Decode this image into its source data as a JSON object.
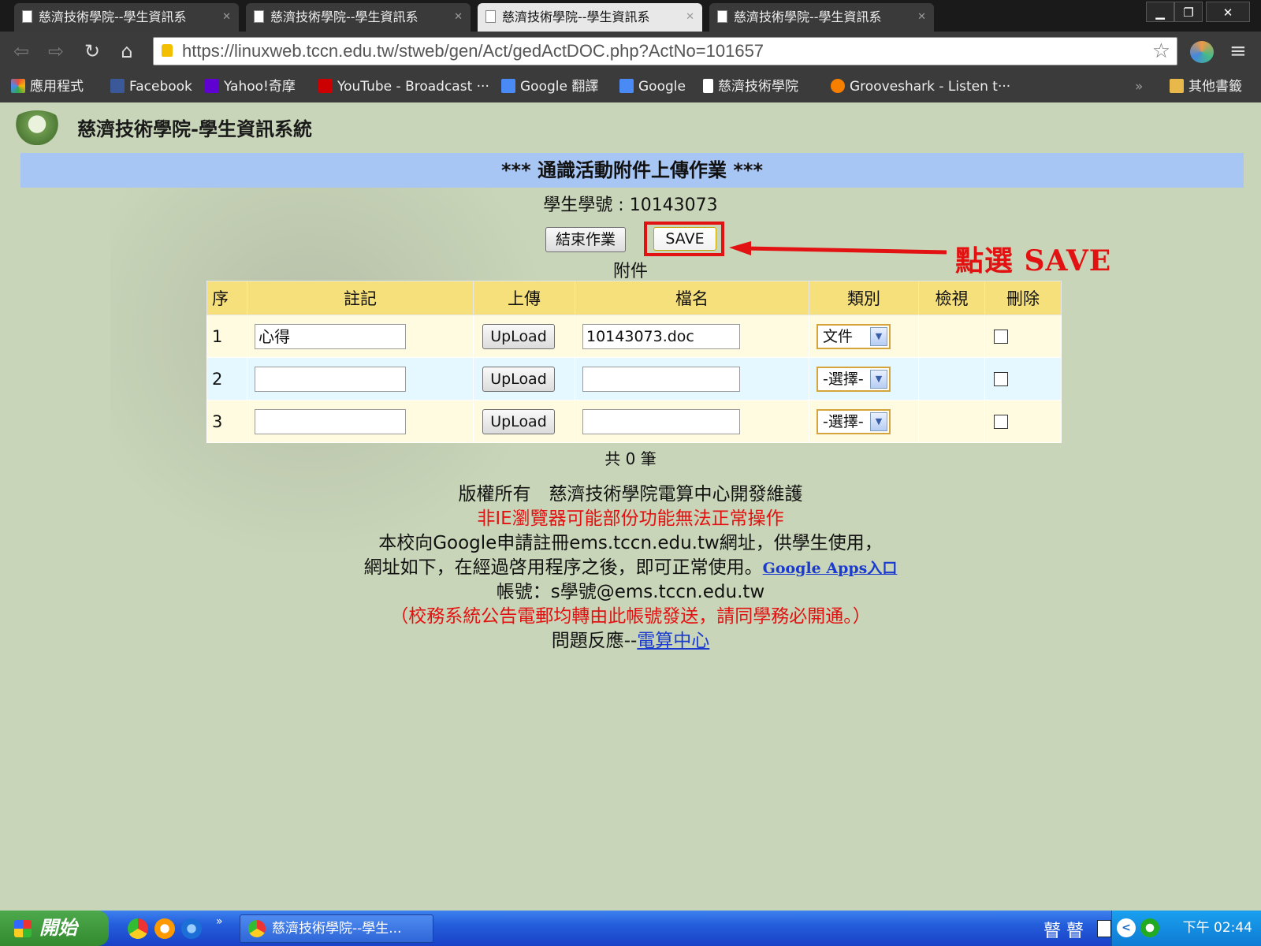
{
  "browser": {
    "tabs": [
      {
        "title": "慈濟技術學院--學生資訊系"
      },
      {
        "title": "慈濟技術學院--學生資訊系"
      },
      {
        "title": "慈濟技術學院--學生資訊系"
      },
      {
        "title": "慈濟技術學院--學生資訊系"
      }
    ],
    "url": "https://linuxweb.tccn.edu.tw/stweb/gen/Act/gedActDOC.php?ActNo=101657",
    "bookmarks": [
      {
        "label": "應用程式",
        "icon": "apps-grid-icon",
        "color": "#e94b3c"
      },
      {
        "label": "Facebook",
        "icon": "facebook-icon",
        "color": "#3b5998"
      },
      {
        "label": "Yahoo!奇摩",
        "icon": "yahoo-icon",
        "color": "#5f01d1"
      },
      {
        "label": "YouTube - Broadcast ···",
        "icon": "youtube-icon",
        "color": "#cc0000"
      },
      {
        "label": "Google 翻譯",
        "icon": "translate-icon",
        "color": "#4a8af4"
      },
      {
        "label": "Google",
        "icon": "google-icon",
        "color": "#4a8af4"
      },
      {
        "label": "慈濟技術學院",
        "icon": "page-icon",
        "color": "#ffffff"
      },
      {
        "label": "Grooveshark - Listen t···",
        "icon": "grooveshark-icon",
        "color": "#f77f00"
      }
    ],
    "more_bookmarks": "»",
    "other_bookmarks": "其他書籤"
  },
  "page": {
    "site_title": "慈濟技術學院-學生資訊系統",
    "banner": "*** 通識活動附件上傳作業 ***",
    "student_id_label": "學生學號 : 10143073",
    "end_button": "結束作業",
    "save_button": "SAVE",
    "callout": "點選 SAVE",
    "attachment_heading": "附件",
    "table": {
      "headers": [
        "序",
        "註記",
        "上傳",
        "檔名",
        "類別",
        "檢視",
        "刪除"
      ],
      "rows": [
        {
          "seq": "1",
          "note": "心得",
          "upload": "UpLoad",
          "filename": "10143073.doc",
          "category": "文件",
          "view": "",
          "delete": false
        },
        {
          "seq": "2",
          "note": "",
          "upload": "UpLoad",
          "filename": "",
          "category": "-選擇-",
          "view": "",
          "delete": false
        },
        {
          "seq": "3",
          "note": "",
          "upload": "UpLoad",
          "filename": "",
          "category": "-選擇-",
          "view": "",
          "delete": false
        }
      ]
    },
    "total": "共 0 筆",
    "footer": {
      "copyright": "版權所有　慈濟技術學院電算中心開發維護",
      "browser_warning": "非IE瀏覽器可能部份功能無法正常操作",
      "google_line1": "本校向Google申請註冊ems.tccn.edu.tw網址，供學生使用，",
      "google_line2": "網址如下，在經過啓用程序之後，即可正常使用。",
      "google_link": "Google Apps入口",
      "account": "帳號：s學號@ems.tccn.edu.tw",
      "notice": "（校務系統公告電郵均轉由此帳號發送，請同學務必開通。）",
      "feedback_prefix": "問題反應--",
      "feedback_link": "電算中心"
    }
  },
  "taskbar": {
    "start": "開始",
    "task_title": "慈濟技術學院--學生...",
    "ime": "瞽 瞽",
    "clock": "下午 02:44"
  },
  "colors": {
    "page_bg": "#c8d5b8",
    "banner_bg": "#a8c6f4",
    "header_bg": "#f6e07c",
    "highlight_red": "#e21212",
    "link_blue": "#1a3ad0"
  }
}
